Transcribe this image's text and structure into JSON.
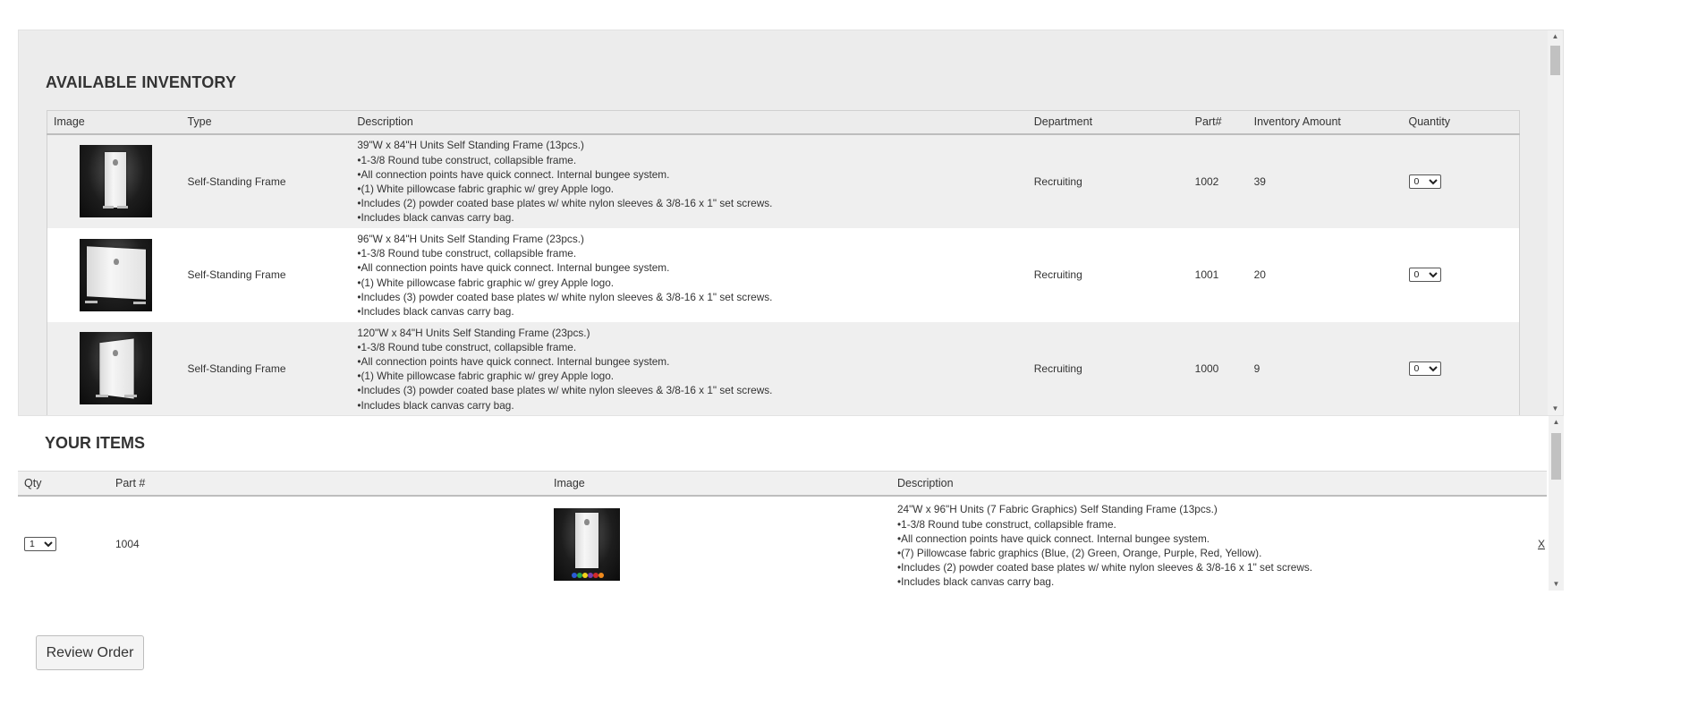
{
  "inventory": {
    "title": "AVAILABLE INVENTORY",
    "columns": {
      "image": "Image",
      "type": "Type",
      "description": "Description",
      "department": "Department",
      "part": "Part#",
      "inventory_amount": "Inventory Amount",
      "quantity": "Quantity"
    },
    "rows": [
      {
        "type": "Self-Standing Frame",
        "description": [
          "39\"W x 84\"H Units Self Standing Frame (13pcs.)",
          "•1-3/8 Round tube construct, collapsible frame.",
          "•All connection points have quick connect. Internal bungee system.",
          "•(1) White pillowcase fabric graphic w/ grey Apple logo.",
          "•Includes (2) powder coated base plates w/ white nylon sleeves & 3/8-16 x 1\" set screws.",
          "•Includes black canvas carry bag."
        ],
        "department": "Recruiting",
        "part": "1002",
        "inventory_amount": "39",
        "quantity": "0",
        "image_icon": "narrow-frame-image"
      },
      {
        "type": "Self-Standing Frame",
        "description": [
          "96\"W x 84\"H Units Self Standing Frame (23pcs.)",
          "•1-3/8 Round tube construct, collapsible frame.",
          "•All connection points have quick connect. Internal bungee system.",
          "•(1) White pillowcase fabric graphic w/ grey Apple logo.",
          "•Includes (3) powder coated base plates w/ white nylon sleeves & 3/8-16 x 1\" set screws.",
          "•Includes black canvas carry bag."
        ],
        "department": "Recruiting",
        "part": "1001",
        "inventory_amount": "20",
        "quantity": "0",
        "image_icon": "wide-frame-image"
      },
      {
        "type": "Self-Standing Frame",
        "description": [
          "120\"W x 84\"H Units Self Standing Frame (23pcs.)",
          "•1-3/8 Round tube construct, collapsible frame.",
          "•All connection points have quick connect. Internal bungee system.",
          "•(1) White pillowcase fabric graphic w/ grey Apple logo.",
          "•Includes (3) powder coated base plates w/ white nylon sleeves & 3/8-16 x 1\" set screws.",
          "•Includes black canvas carry bag."
        ],
        "department": "Recruiting",
        "part": "1000",
        "inventory_amount": "9",
        "quantity": "0",
        "image_icon": "angled-frame-image"
      }
    ]
  },
  "your_items": {
    "title": "YOUR ITEMS",
    "columns": {
      "qty": "Qty",
      "part": "Part #",
      "image": "Image",
      "description": "Description"
    },
    "rows": [
      {
        "qty": "1",
        "part": "1004",
        "description": [
          "24\"W x 96\"H Units (7 Fabric Graphics) Self Standing Frame (13pcs.)",
          "•1-3/8 Round tube construct, collapsible frame.",
          "•All connection points have quick connect. Internal bungee system.",
          "•(7) Pillowcase fabric graphics (Blue, (2) Green, Orange, Purple, Red, Yellow).",
          "•Includes (2) powder coated base plates w/ white nylon sleeves & 3/8-16 x 1\" set screws.",
          "•Includes black canvas carry bag."
        ],
        "remove_label": "X",
        "image_icon": "tall-frame-with-swatches-image"
      }
    ]
  },
  "review_button": "Review Order",
  "colors": {
    "panel_bg": "#ececec",
    "row_alt": "#ffffff",
    "header_border": "#bdbdbd",
    "swatch_blue": "#2a5bd7",
    "swatch_green": "#2aa84a",
    "swatch_orange": "#f08a1c",
    "swatch_purple": "#7b3fb0",
    "swatch_red": "#d22a2a",
    "swatch_yellow": "#f2d21b"
  }
}
